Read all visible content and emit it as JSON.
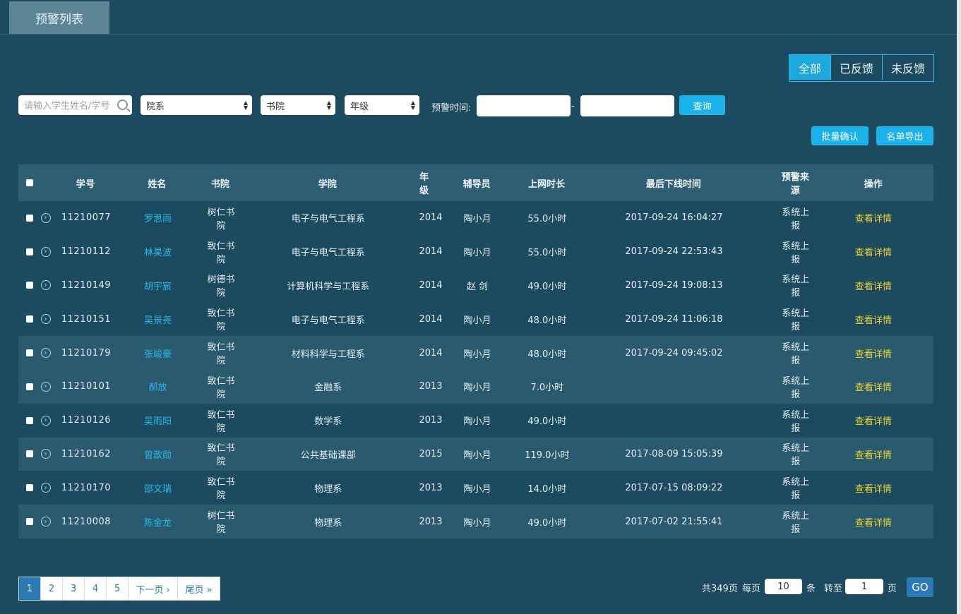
{
  "header": {
    "tab_label": "预警列表"
  },
  "filters": {
    "status_tabs": [
      "全部",
      "已反馈",
      "未反馈"
    ],
    "search_placeholder": "请输入学生姓名/学号",
    "dept_select": "院系",
    "college_select": "书院",
    "grade_select": "年级",
    "time_label": "预警时间:",
    "time_separator": "-",
    "query_button": "查询"
  },
  "actions": {
    "batch_confirm": "批量确认",
    "export_list": "名单导出"
  },
  "table": {
    "headers": [
      "学号",
      "姓名",
      "书院",
      "学院",
      "年级",
      "辅导员",
      "上网时长",
      "最后下线时间",
      "预警来源",
      "操作"
    ],
    "rows": [
      {
        "id": "11210077",
        "name": "罗思雨",
        "college": "树仁书院",
        "dept": "电子与电气工程系",
        "grade": "2014",
        "tutor": "陶小月",
        "hours": "55.0小时",
        "last": "2017-09-24 16:04:27",
        "source": "系统上报",
        "op": "查看详情"
      },
      {
        "id": "11210112",
        "name": "林昊波",
        "college": "致仁书院",
        "dept": "电子与电气工程系",
        "grade": "2014",
        "tutor": "陶小月",
        "hours": "55.0小时",
        "last": "2017-09-24 22:53:43",
        "source": "系统上报",
        "op": "查看详情"
      },
      {
        "id": "11210149",
        "name": "胡宇宸",
        "college": "树德书院",
        "dept": "计算机科学与工程系",
        "grade": "2014",
        "tutor": "赵 剑",
        "hours": "49.0小时",
        "last": "2017-09-24 19:08:13",
        "source": "系统上报",
        "op": "查看详情"
      },
      {
        "id": "11210151",
        "name": "吴景尧",
        "college": "致仁书院",
        "dept": "电子与电气工程系",
        "grade": "2014",
        "tutor": "陶小月",
        "hours": "48.0小时",
        "last": "2017-09-24 11:06:18",
        "source": "系统上报",
        "op": "查看详情"
      },
      {
        "id": "11210179",
        "name": "张峻豪",
        "college": "致仁书院",
        "dept": "材料科学与工程系",
        "grade": "2014",
        "tutor": "陶小月",
        "hours": "48.0小时",
        "last": "2017-09-24 09:45:02",
        "source": "系统上报",
        "op": "查看详情"
      },
      {
        "id": "11210101",
        "name": "郝放",
        "college": "致仁书院",
        "dept": "金融系",
        "grade": "2013",
        "tutor": "陶小月",
        "hours": "7.0小时",
        "last": "",
        "source": "系统上报",
        "op": "查看详情"
      },
      {
        "id": "11210126",
        "name": "吴雨阳",
        "college": "致仁书院",
        "dept": "数学系",
        "grade": "2013",
        "tutor": "陶小月",
        "hours": "49.0小时",
        "last": "",
        "source": "系统上报",
        "op": "查看详情"
      },
      {
        "id": "11210162",
        "name": "曾歆勋",
        "college": "致仁书院",
        "dept": "公共基础课部",
        "grade": "2015",
        "tutor": "陶小月",
        "hours": "119.0小时",
        "last": "2017-08-09 15:05:39",
        "source": "系统上报",
        "op": "查看详情"
      },
      {
        "id": "11210170",
        "name": "邵文瑞",
        "college": "致仁书院",
        "dept": "物理系",
        "grade": "2013",
        "tutor": "陶小月",
        "hours": "14.0小时",
        "last": "2017-07-15 08:09:22",
        "source": "系统上报",
        "op": "查看详情"
      },
      {
        "id": "11210008",
        "name": "陈金龙",
        "college": "树仁书院",
        "dept": "物理系",
        "grade": "2013",
        "tutor": "陶小月",
        "hours": "49.0小时",
        "last": "2017-07-02 21:55:41",
        "source": "系统上报",
        "op": "查看详情"
      }
    ]
  },
  "pagination": {
    "pages": [
      "1",
      "2",
      "3",
      "4",
      "5"
    ],
    "next": "下一页 ›",
    "last": "尾页 »",
    "total_text": "共349页",
    "per_page_label": "每页",
    "per_page_value": "10",
    "per_page_unit": "条",
    "goto_label": "转至",
    "goto_value": "1",
    "goto_unit": "页",
    "go_button": "GO"
  },
  "colors": {
    "accent": "#1ab2ea",
    "link": "#28b8ea",
    "action_link": "#e9d22e",
    "background": "#1c4a5f"
  }
}
